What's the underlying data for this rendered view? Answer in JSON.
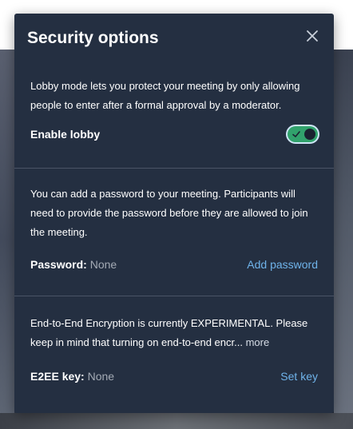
{
  "dialog": {
    "title": "Security options",
    "close_icon": "close-icon"
  },
  "lobby": {
    "description": "Lobby mode lets you protect your meeting by only allowing people to enter after a formal approval by a moderator.",
    "label": "Enable lobby",
    "enabled": true,
    "toggle_color": "#31a26c"
  },
  "password": {
    "description": "You can add a password to your meeting. Participants will need to provide the password before they are allowed to join the meeting.",
    "label": "Password:",
    "value": "None",
    "action": "Add password"
  },
  "e2ee": {
    "description": "End-to-End Encryption is currently EXPERIMENTAL. Please keep in mind that turning on end-to-end encr...",
    "more": "more",
    "label": "E2EE key:",
    "value": "None",
    "action": "Set key"
  },
  "colors": {
    "dialog_bg": "#242f41",
    "link": "#6fb3ea",
    "muted": "#a4abb5"
  }
}
